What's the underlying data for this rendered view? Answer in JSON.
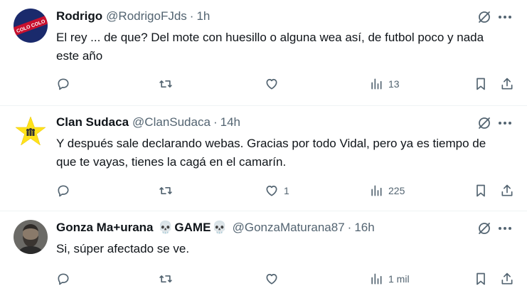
{
  "tweets": [
    {
      "name": "Rodrigo",
      "handle": "@RodrigoFJds",
      "time": "1h",
      "text": "El rey ... de que? Del mote con huesillo o alguna wea así, de futbol poco y nada este año",
      "avatar_text": "COLO COLO",
      "likes": "",
      "views": "13"
    },
    {
      "name": "Clan Sudaca",
      "handle": "@ClanSudaca",
      "time": "14h",
      "text": "Y después sale declarando webas. Gracias por todo Vidal, pero ya es tiempo de que te vayas, tienes la cagá en el camarín.",
      "likes": "1",
      "views": "225"
    },
    {
      "name_part1": "Gonza Ma+urana",
      "name_part2": "GAME",
      "skull": "💀",
      "handle": "@GonzaMaturana87",
      "time": "16h",
      "text": "Si, súper afectado se ve.",
      "likes": "",
      "views": "1 mil"
    }
  ],
  "separator": "·",
  "colors": {
    "text": "#0f1419",
    "secondary": "#536471",
    "divider": "#eff3f4",
    "colo_colo_red": "#c8102e",
    "colo_colo_blue": "#1a2a6c",
    "star_yellow": "#ffe21a"
  },
  "icons": [
    "reply-icon",
    "retweet-icon",
    "like-icon",
    "views-icon",
    "bookmark-icon",
    "share-icon",
    "grok-icon",
    "more-icon"
  ]
}
